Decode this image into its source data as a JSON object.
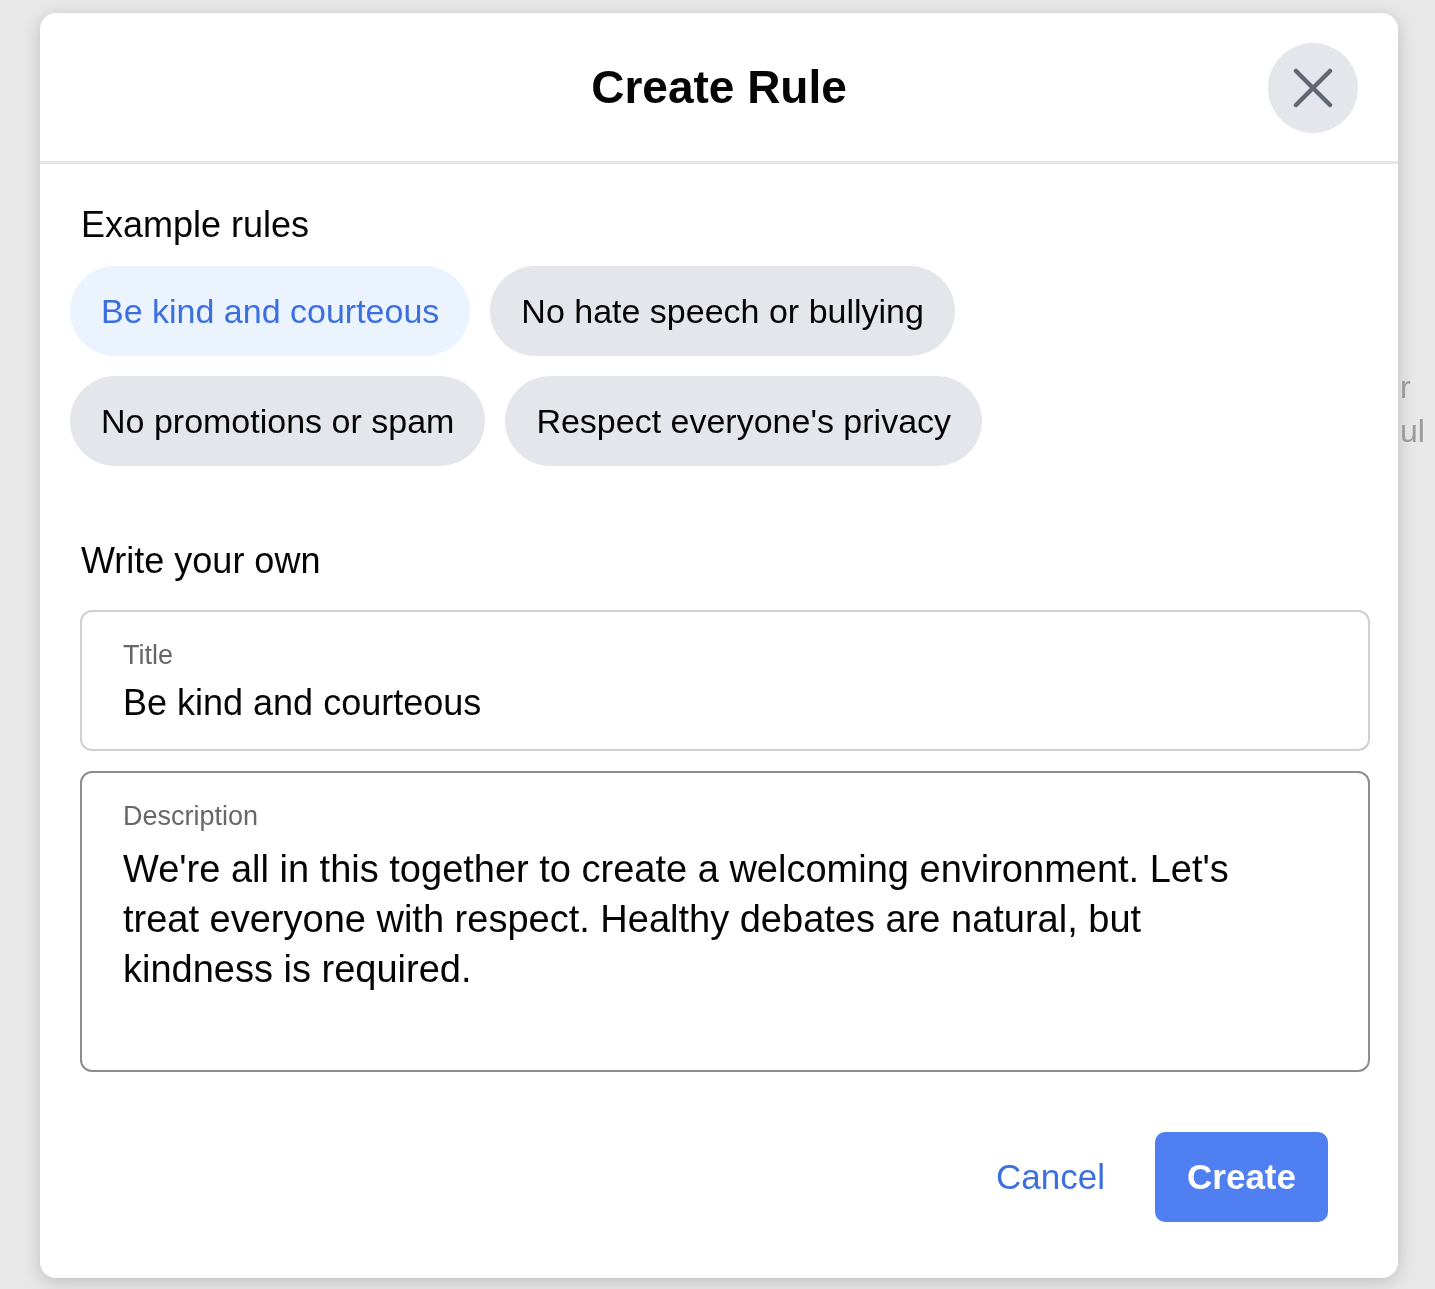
{
  "background_text": [
    "r",
    "ul"
  ],
  "dialog": {
    "title": "Create Rule"
  },
  "example_rules": {
    "heading": "Example rules",
    "chips": [
      {
        "label": "Be kind and courteous",
        "selected": true
      },
      {
        "label": "No hate speech or bullying",
        "selected": false
      },
      {
        "label": "No promotions or spam",
        "selected": false
      },
      {
        "label": "Respect everyone's privacy",
        "selected": false
      }
    ]
  },
  "write_your_own": {
    "heading": "Write your own",
    "fields": [
      {
        "label": "Title",
        "value": "Be kind and courteous",
        "kind": "input",
        "focused": false
      },
      {
        "label": "Description",
        "value": "We're all in this together to create a welcoming environment. Let's treat everyone with respect. Healthy debates are natural, but kindness is required.",
        "kind": "textarea",
        "focused": true
      }
    ]
  },
  "buttons": [
    {
      "label": "Cancel",
      "kind": "text"
    },
    {
      "label": "Create",
      "kind": "primary"
    }
  ]
}
